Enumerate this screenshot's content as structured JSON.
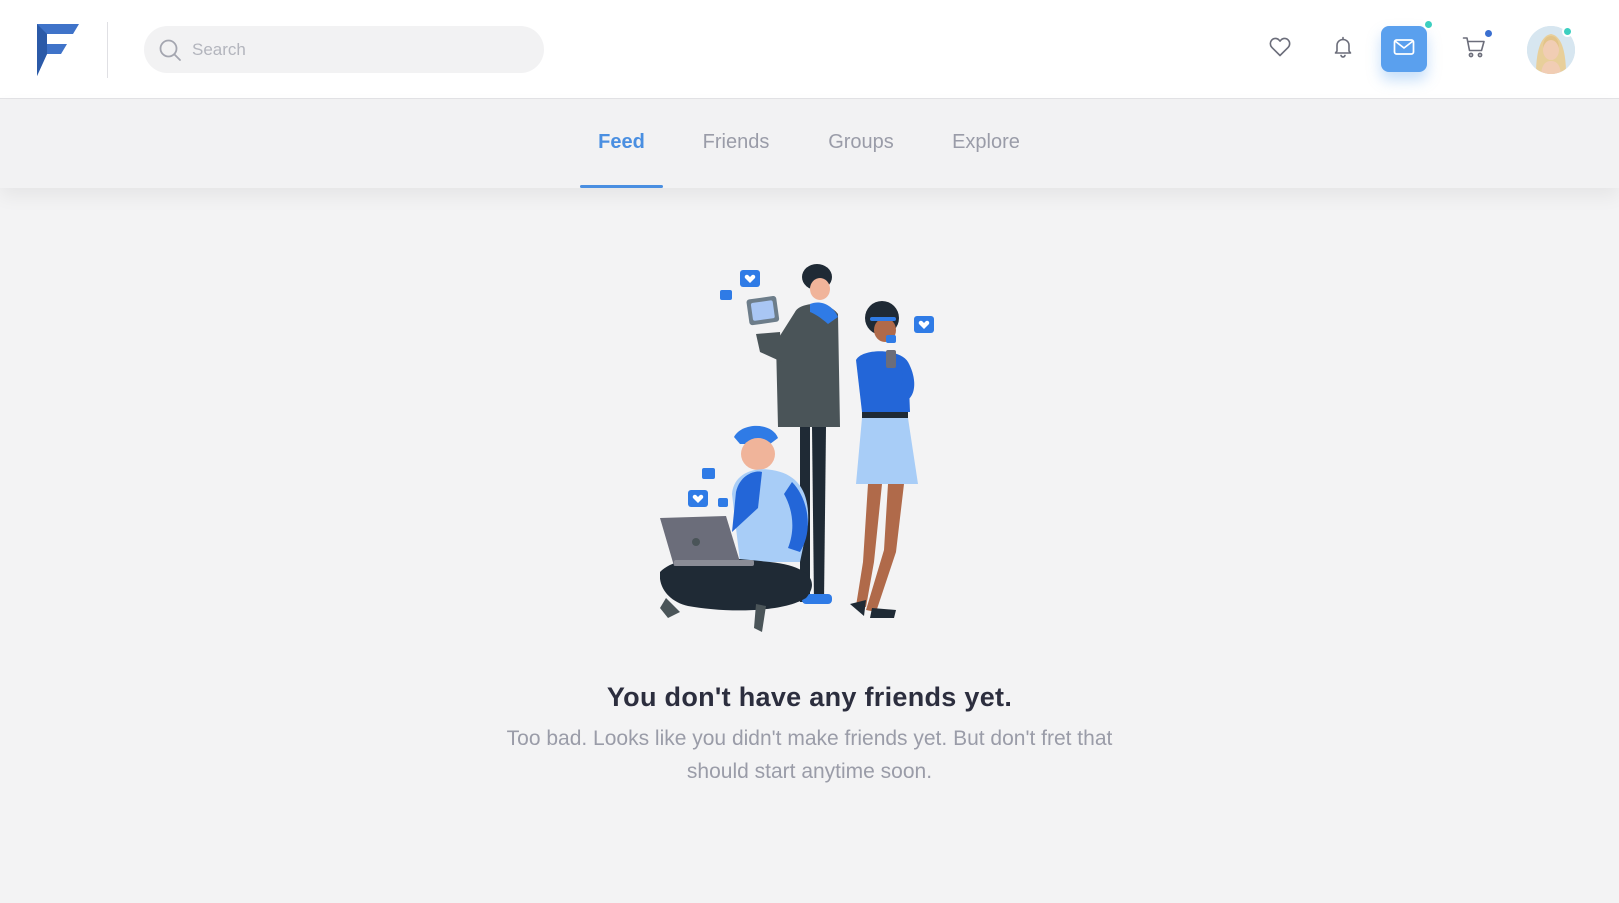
{
  "header": {
    "logo_icon": "brand-logo",
    "search": {
      "placeholder": "Search",
      "value": "",
      "icon": "search-icon"
    },
    "icons": [
      "heart-icon",
      "bell-icon",
      "mail-icon",
      "cart-icon"
    ],
    "accent_color": "#5aa0ee",
    "badge_colors": {
      "mail": "#3ccfc0",
      "cart": "#3a6fd0",
      "avatar": "#3ccfc0"
    }
  },
  "tabs": [
    {
      "label": "Feed",
      "active": true
    },
    {
      "label": "Friends",
      "active": false
    },
    {
      "label": "Groups",
      "active": false
    },
    {
      "label": "Explore",
      "active": false
    }
  ],
  "empty_state": {
    "title": "You don't have any friends yet.",
    "text": "Too bad. Looks like you didn't make friends yet. But don't fret that should start anytime soon."
  }
}
